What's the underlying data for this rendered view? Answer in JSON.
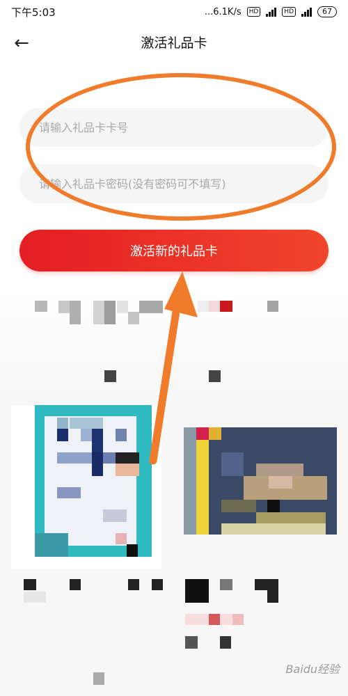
{
  "status_bar": {
    "time": "下午5:03",
    "network_speed": "...6.1K/s",
    "hd_badge": "HD",
    "net_type": "4G",
    "battery": "67"
  },
  "header": {
    "title": "激活礼品卡"
  },
  "form": {
    "card_number_placeholder": "请输入礼品卡卡号",
    "card_password_placeholder": "请输入礼品卡密码(没有密码可不填写)",
    "activate_button": "激活新的礼品卡"
  },
  "watermark": "Baidu经验",
  "colors": {
    "accent_red": "#e31e24",
    "annotation_orange": "#f07b2a"
  }
}
